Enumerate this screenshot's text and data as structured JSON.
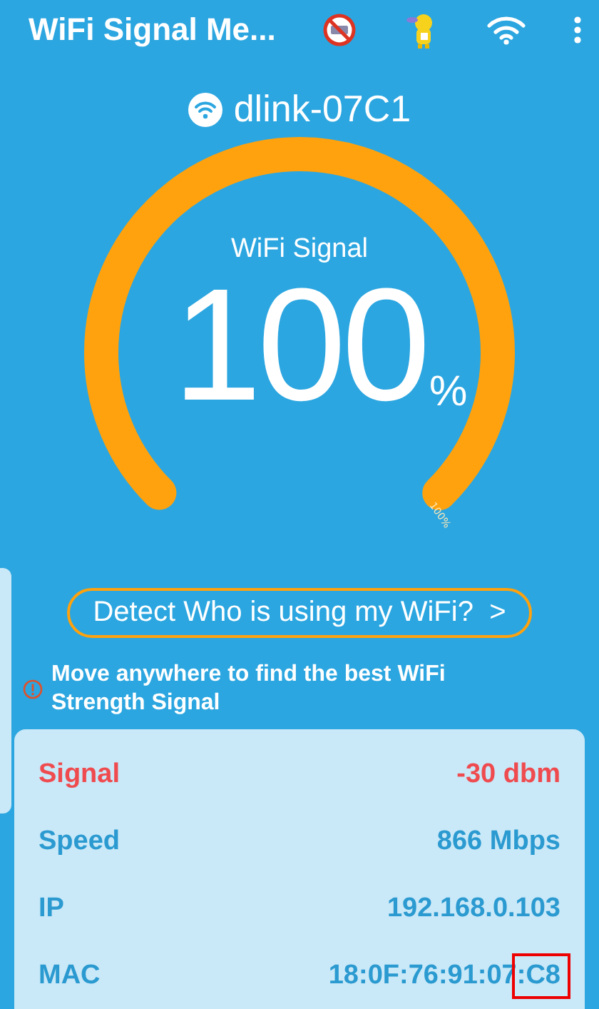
{
  "app_bar": {
    "title": "WiFi Signal Me..."
  },
  "network": {
    "name": "dlink-07C1"
  },
  "gauge": {
    "label": "WiFi Signal",
    "value": "100",
    "unit": "%",
    "end_label": "100%"
  },
  "detect_button": {
    "label": "Detect Who is using my WiFi?",
    "chevron": ">"
  },
  "tip": {
    "text": "Move anywhere to find the best WiFi Strength Signal"
  },
  "stats": [
    {
      "label": "Signal",
      "value": "-30 dbm",
      "kind": "alert",
      "highlighted": false
    },
    {
      "label": "Speed",
      "value": "866 Mbps",
      "kind": "normal",
      "highlighted": false
    },
    {
      "label": "IP",
      "value": "192.168.0.103",
      "kind": "normal",
      "highlighted": false
    },
    {
      "label": "MAC",
      "value": "18:0F:76:91:07:C8",
      "kind": "normal",
      "highlighted": true
    }
  ]
}
